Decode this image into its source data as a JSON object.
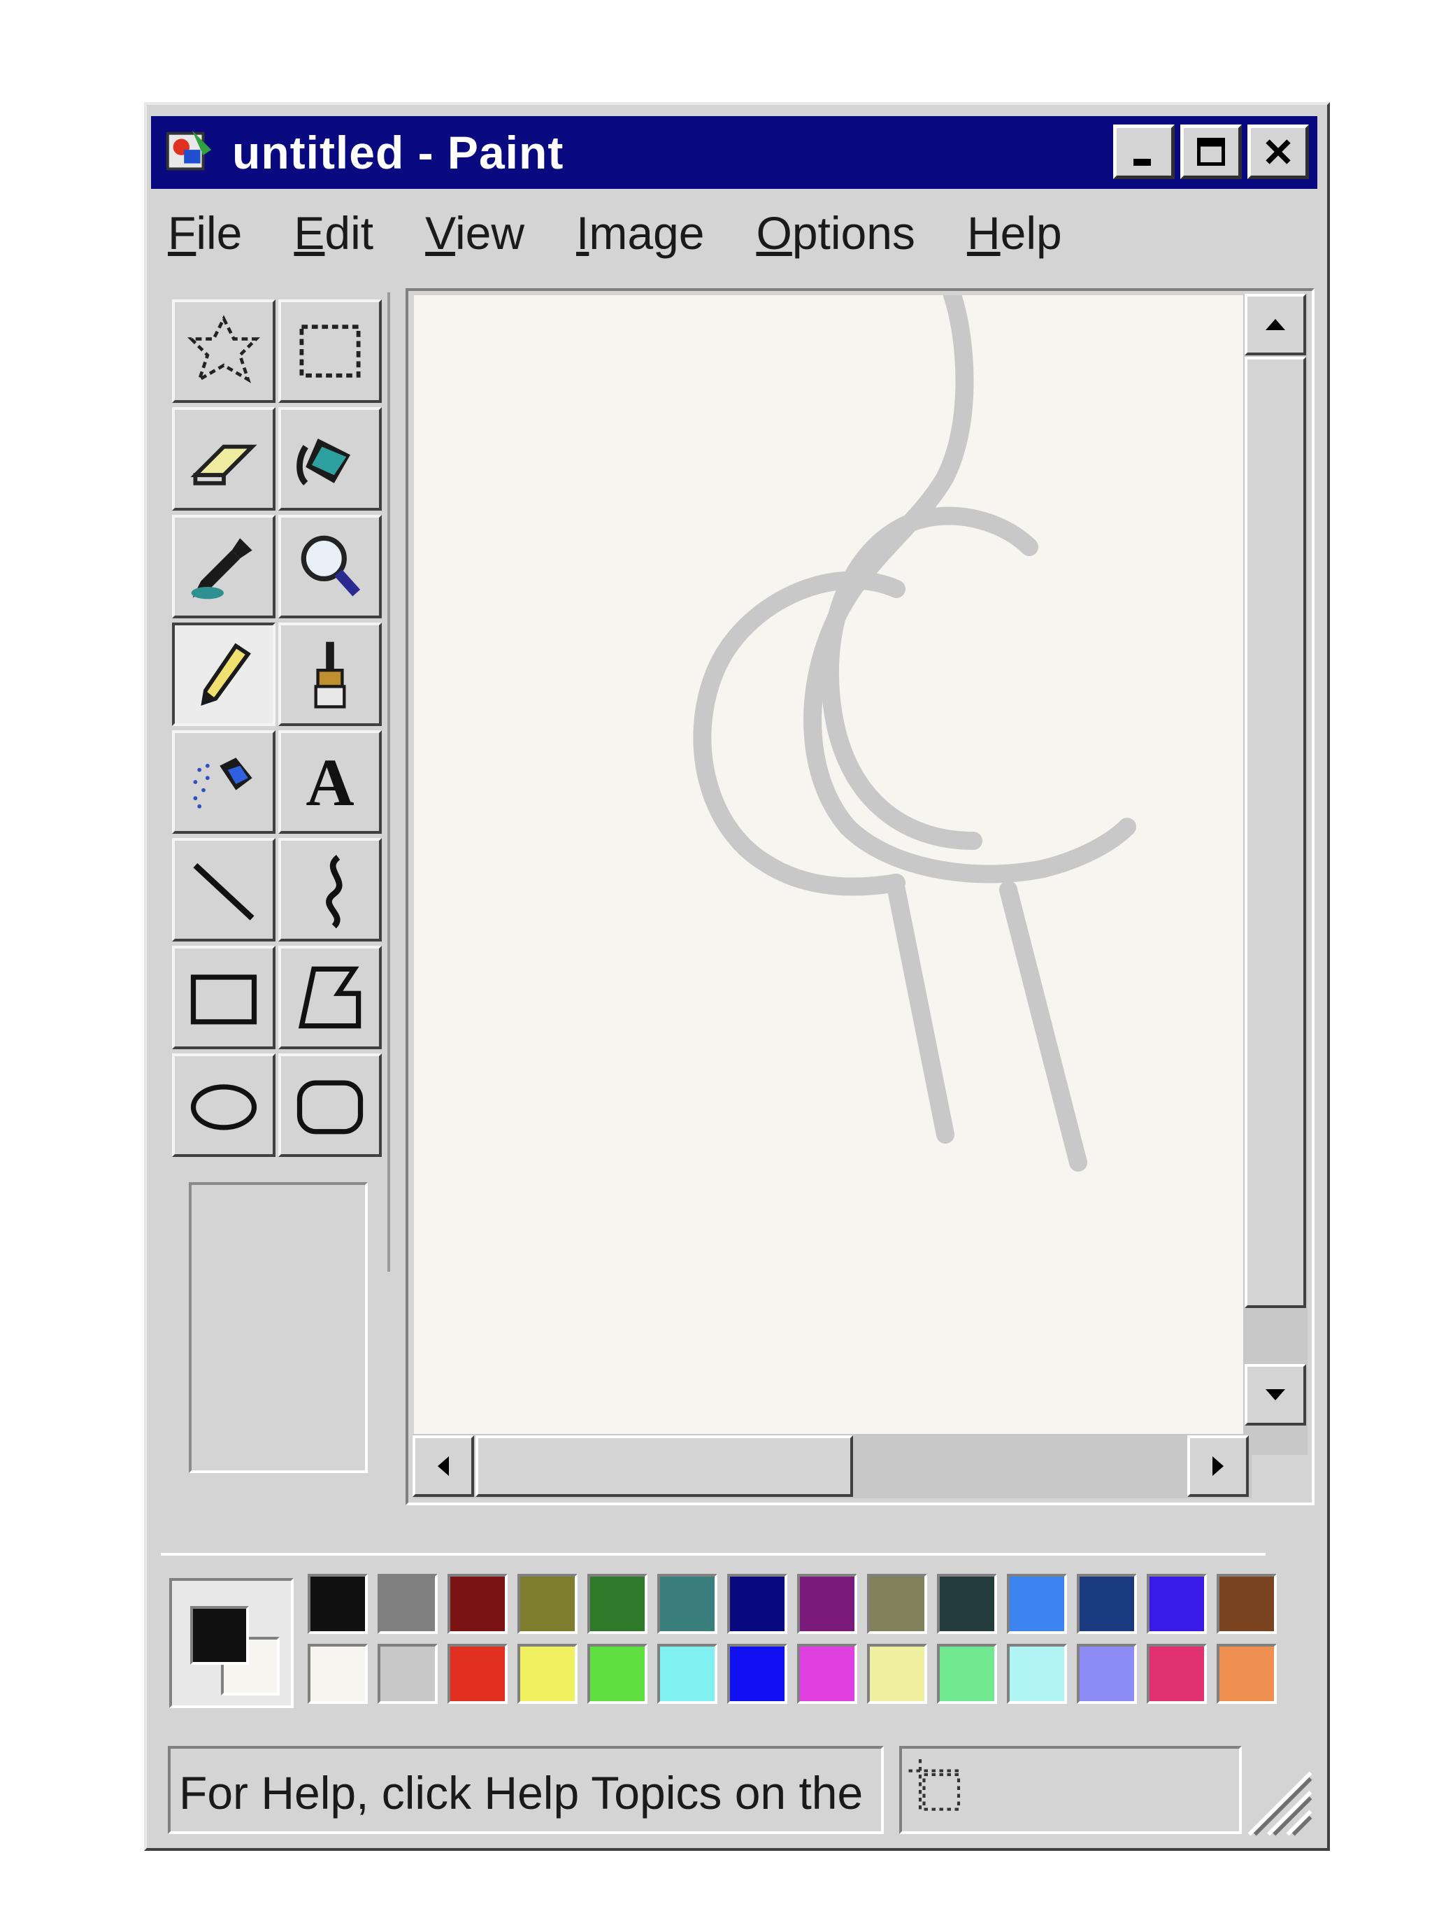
{
  "window": {
    "title": "untitled - Paint",
    "app_icon": "paint-app-icon",
    "buttons": [
      "minimize-icon",
      "maximize-icon",
      "close-icon"
    ]
  },
  "menu": [
    {
      "first": "F",
      "rest": "ile",
      "label": "File"
    },
    {
      "first": "E",
      "rest": "dit",
      "label": "Edit"
    },
    {
      "first": "V",
      "rest": "iew",
      "label": "View"
    },
    {
      "first": "I",
      "rest": "mage",
      "label": "Image"
    },
    {
      "first": "O",
      "rest": "ptions",
      "label": "Options"
    },
    {
      "first": "H",
      "rest": "elp",
      "label": "Help"
    }
  ],
  "tools": [
    {
      "name": "free-form-select",
      "icon": "free-form-select-icon"
    },
    {
      "name": "select",
      "icon": "rectangle-select-icon"
    },
    {
      "name": "eraser",
      "icon": "eraser-icon"
    },
    {
      "name": "fill-with-color",
      "icon": "paint-bucket-icon"
    },
    {
      "name": "pick-color",
      "icon": "eyedropper-icon"
    },
    {
      "name": "magnifier",
      "icon": "magnifier-icon"
    },
    {
      "name": "pencil",
      "icon": "pencil-icon",
      "active": true
    },
    {
      "name": "brush",
      "icon": "brush-icon"
    },
    {
      "name": "airbrush",
      "icon": "airbrush-icon"
    },
    {
      "name": "text",
      "icon": "text-icon",
      "glyph": "A"
    },
    {
      "name": "line",
      "icon": "line-icon"
    },
    {
      "name": "curve",
      "icon": "curve-icon"
    },
    {
      "name": "rectangle",
      "icon": "rectangle-icon"
    },
    {
      "name": "polygon",
      "icon": "polygon-icon"
    },
    {
      "name": "ellipse",
      "icon": "ellipse-icon"
    },
    {
      "name": "rounded-rectangle",
      "icon": "rounded-rectangle-icon"
    }
  ],
  "colors": {
    "foreground": "#101010",
    "background": "#f7f5ef",
    "palette_top": [
      "#101010",
      "#808080",
      "#7a1414",
      "#7e7e2e",
      "#2e7a2a",
      "#3a7e7e",
      "#0a0a80",
      "#7a1a7a",
      "#80805a",
      "#243c3c",
      "#3e84f0",
      "#1a3a80",
      "#3a1ae8",
      "#7a4420"
    ],
    "palette_bottom": [
      "#f7f5ef",
      "#c8c8c8",
      "#e23020",
      "#f0f060",
      "#60e040",
      "#80f0f0",
      "#1010f0",
      "#e040e0",
      "#f0f0a0",
      "#70e890",
      "#b0f4f4",
      "#8c8cf4",
      "#e03070",
      "#f09050"
    ]
  },
  "status": {
    "help_text": "For Help, click Help Topics on the"
  }
}
